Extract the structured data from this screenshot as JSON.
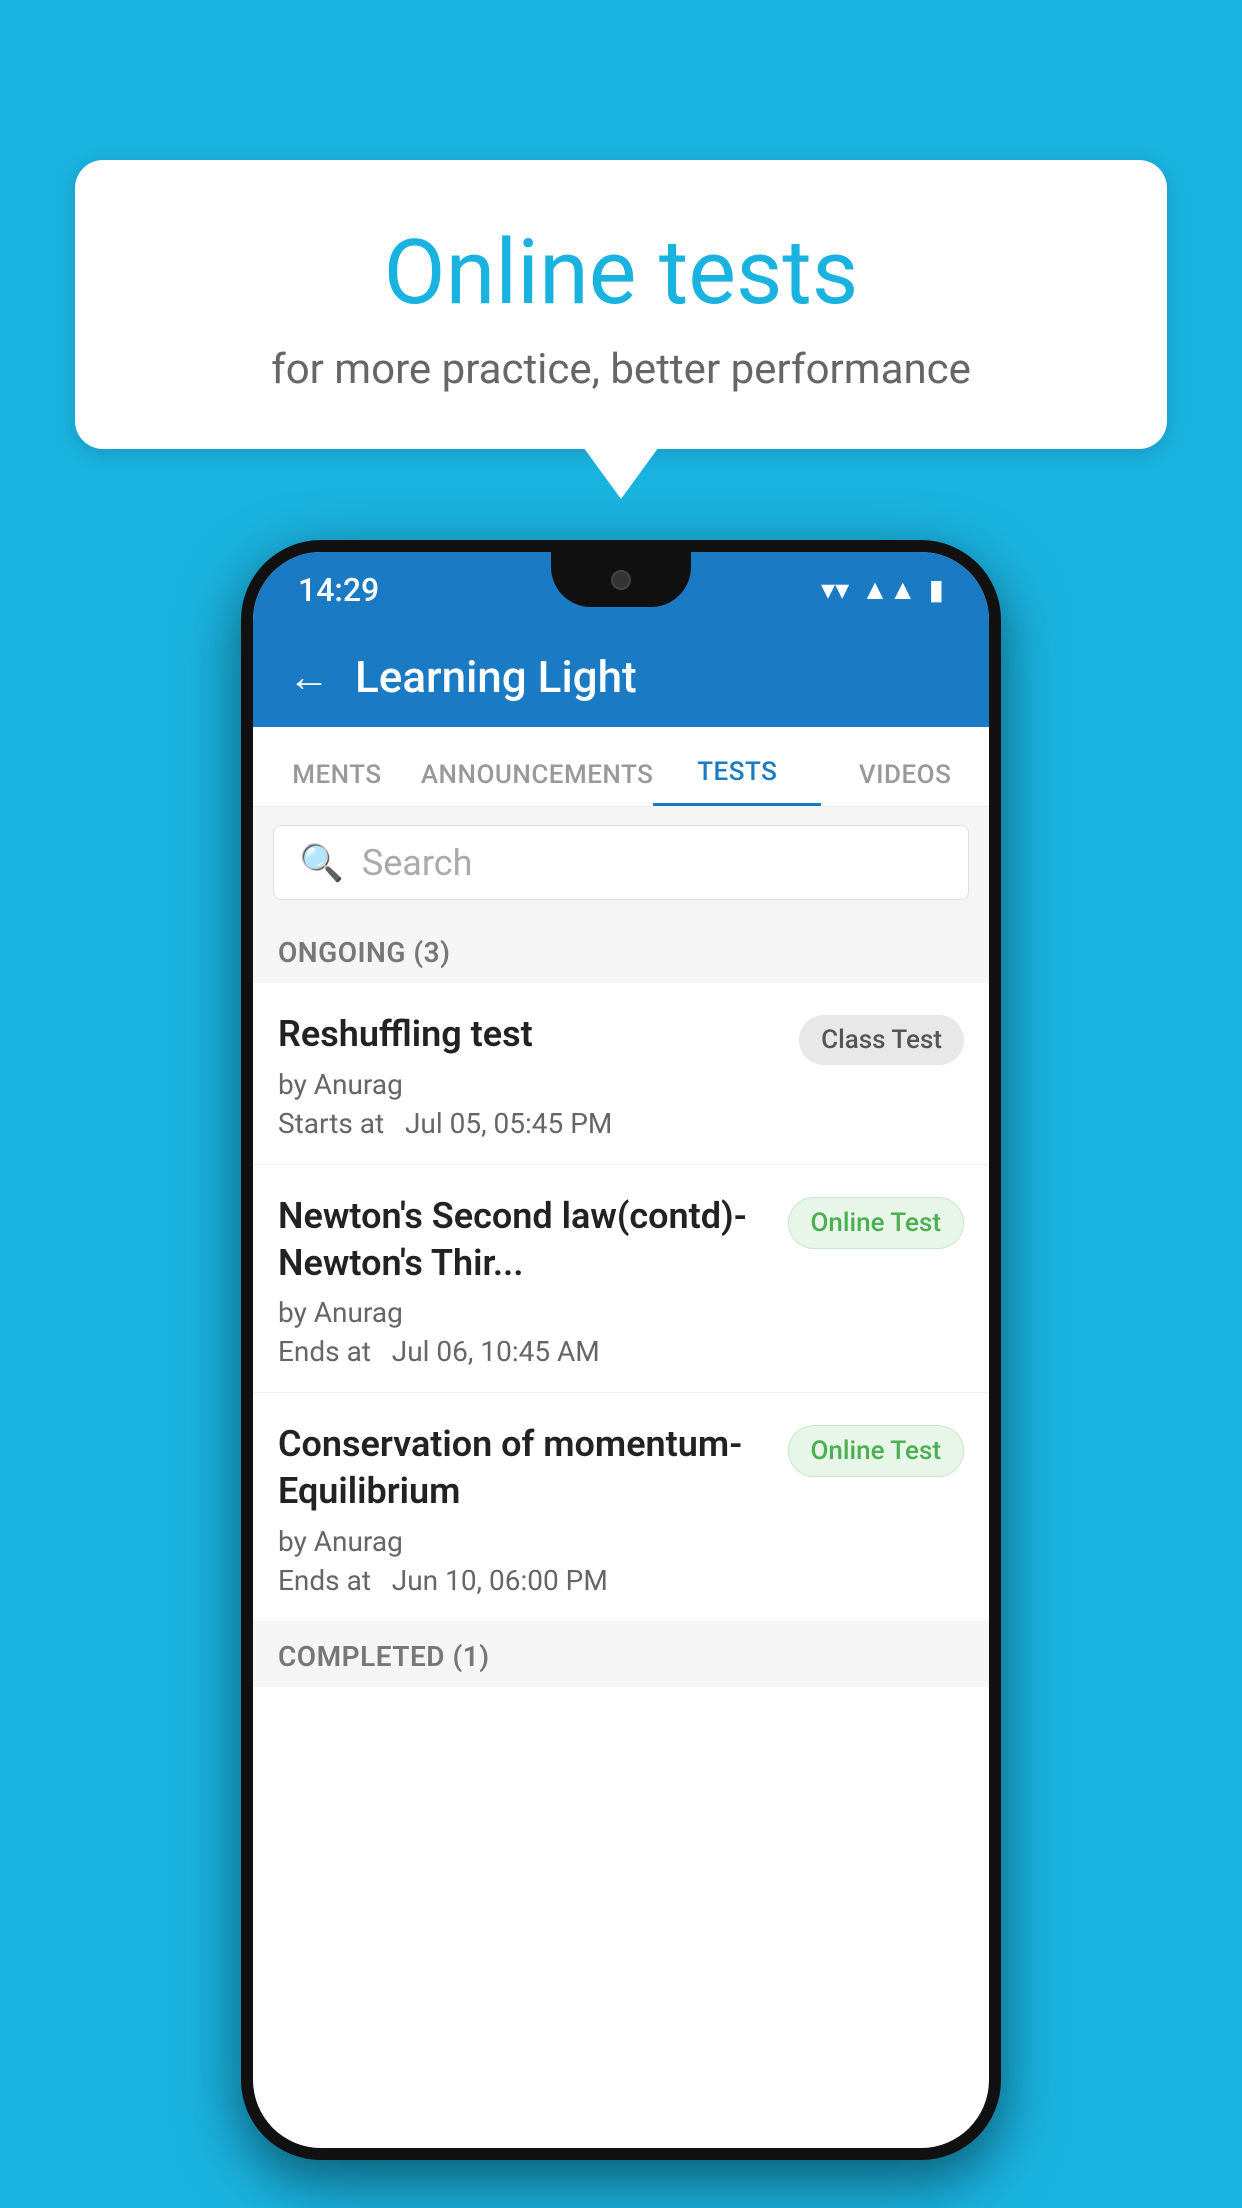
{
  "background_color": "#1ab3e0",
  "bubble": {
    "title": "Online tests",
    "subtitle": "for more practice, better performance"
  },
  "status_bar": {
    "time": "14:29",
    "wifi": "▼",
    "signal": "▲",
    "battery": "▮"
  },
  "app_bar": {
    "title": "Learning Light",
    "back_label": "←"
  },
  "tabs": [
    {
      "label": "MENTS",
      "active": false
    },
    {
      "label": "ANNOUNCEMENTS",
      "active": false
    },
    {
      "label": "TESTS",
      "active": true
    },
    {
      "label": "VIDEOS",
      "active": false
    }
  ],
  "search": {
    "placeholder": "Search"
  },
  "ongoing_section": {
    "label": "ONGOING (3)"
  },
  "tests": [
    {
      "name": "Reshuffling test",
      "author": "by Anurag",
      "time_label": "Starts at",
      "time": "Jul 05, 05:45 PM",
      "badge": "Class Test",
      "badge_type": "class"
    },
    {
      "name": "Newton's Second law(contd)-Newton's Thir...",
      "author": "by Anurag",
      "time_label": "Ends at",
      "time": "Jul 06, 10:45 AM",
      "badge": "Online Test",
      "badge_type": "online"
    },
    {
      "name": "Conservation of momentum-Equilibrium",
      "author": "by Anurag",
      "time_label": "Ends at",
      "time": "Jun 10, 06:00 PM",
      "badge": "Online Test",
      "badge_type": "online"
    }
  ],
  "completed_section": {
    "label": "COMPLETED (1)"
  }
}
